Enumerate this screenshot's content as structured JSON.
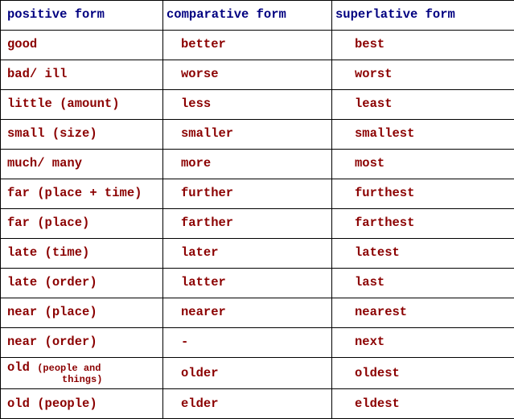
{
  "chart_data": {
    "type": "table",
    "title": "",
    "columns": [
      "positive form",
      "comparative form",
      "superlative form"
    ],
    "rows": [
      [
        "good",
        "better",
        "best"
      ],
      [
        "bad/ ill",
        "worse",
        "worst"
      ],
      [
        "little (amount)",
        "less",
        "least"
      ],
      [
        "small (size)",
        "smaller",
        "smallest"
      ],
      [
        "much/ many",
        "more",
        "most"
      ],
      [
        "far (place + time)",
        "further",
        "furthest"
      ],
      [
        "far (place)",
        "farther",
        "farthest"
      ],
      [
        "late (time)",
        "later",
        "latest"
      ],
      [
        "late (order)",
        "latter",
        "last"
      ],
      [
        "near (place)",
        "nearer",
        "nearest"
      ],
      [
        "near (order)",
        "-",
        "next"
      ],
      [
        "old (people and things)",
        "older",
        "oldest"
      ],
      [
        "old (people)",
        "elder",
        "eldest"
      ]
    ]
  },
  "headers": {
    "c0": "positive form",
    "c1": "comparative form",
    "c2": "superlative form"
  },
  "rows": {
    "r0": {
      "c0_a": "good",
      "c0_b": "",
      "c1": "better",
      "c2": "best"
    },
    "r1": {
      "c0_a": "bad/ ill",
      "c0_b": "",
      "c1": "worse",
      "c2": "worst"
    },
    "r2": {
      "c0_a": "little ",
      "c0_b": "(amount)",
      "c1": "less",
      "c2": "least"
    },
    "r3": {
      "c0_a": "small ",
      "c0_b": "(size)",
      "c1": "smaller",
      "c2": "smallest"
    },
    "r4": {
      "c0_a": "much/ many",
      "c0_b": "",
      "c1": "more",
      "c2": "most"
    },
    "r5": {
      "c0_a": "far ",
      "c0_b": "(place + time)",
      "c1": "further",
      "c2": "furthest"
    },
    "r6": {
      "c0_a": "far ",
      "c0_b": "(place)",
      "c1": "farther",
      "c2": "farthest"
    },
    "r7": {
      "c0_a": "late ",
      "c0_b": "(time)",
      "c1": "later",
      "c2": "latest"
    },
    "r8": {
      "c0_a": "late ",
      "c0_b": "(order)",
      "c1": "latter",
      "c2": "last"
    },
    "r9": {
      "c0_a": "near ",
      "c0_b": "(place)",
      "c1": "nearer",
      "c2": "nearest"
    },
    "r10": {
      "c0_a": "near ",
      "c0_b": "(order)",
      "c1": "-",
      "c2": "next"
    },
    "r11": {
      "c0_a": "old ",
      "c0_b": "(people and",
      "c0_c": "things)",
      "c1": "older",
      "c2": "oldest"
    },
    "r12": {
      "c0_a": "old ",
      "c0_b": "(people)",
      "c1": "elder",
      "c2": "eldest"
    }
  }
}
